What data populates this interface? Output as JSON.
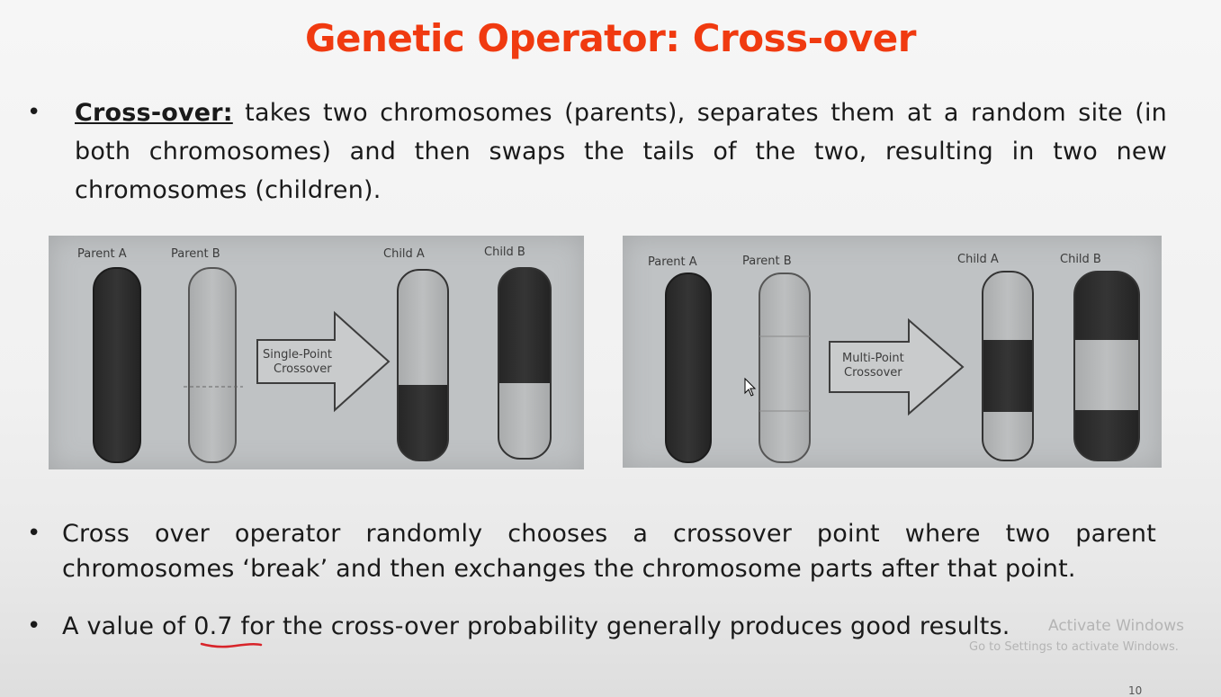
{
  "slide": {
    "title": "Genetic Operator: Cross-over",
    "page_number": "10"
  },
  "bullets": {
    "b1_term": "Cross-over:",
    "b1_text": " takes two chromosomes (parents), separates them at a random site (in both chromosomes) and then swaps the tails of the two, resulting in two new chromosomes (children).",
    "b2_text": "Cross over operator randomly chooses a crossover point where two parent chromosomes ‘break’ and then exchanges the chromosome parts after that point.",
    "b3_prefix": "A value of ",
    "b3_highlight": "0.7",
    "b3_suffix": " for the cross-over probability generally produces good results."
  },
  "figures": {
    "single": {
      "parent_a": "Parent A",
      "parent_b": "Parent B",
      "child_a": "Child A",
      "child_b": "Child B",
      "arrow_line1": "Single-Point",
      "arrow_line2": "Crossover"
    },
    "multi": {
      "parent_a": "Parent A",
      "parent_b": "Parent B",
      "child_a": "Child A",
      "child_b": "Child B",
      "arrow_line1": "Multi-Point",
      "arrow_line2": "Crossover"
    }
  },
  "watermark": {
    "line1": "Activate Windows",
    "line2": "Go to Settings to activate Windows."
  },
  "colors": {
    "title": "#f03a10",
    "underline": "#d8242a",
    "dark_chromosome": "#2a2a2a",
    "light_chromosome": "#b3b5b6"
  }
}
